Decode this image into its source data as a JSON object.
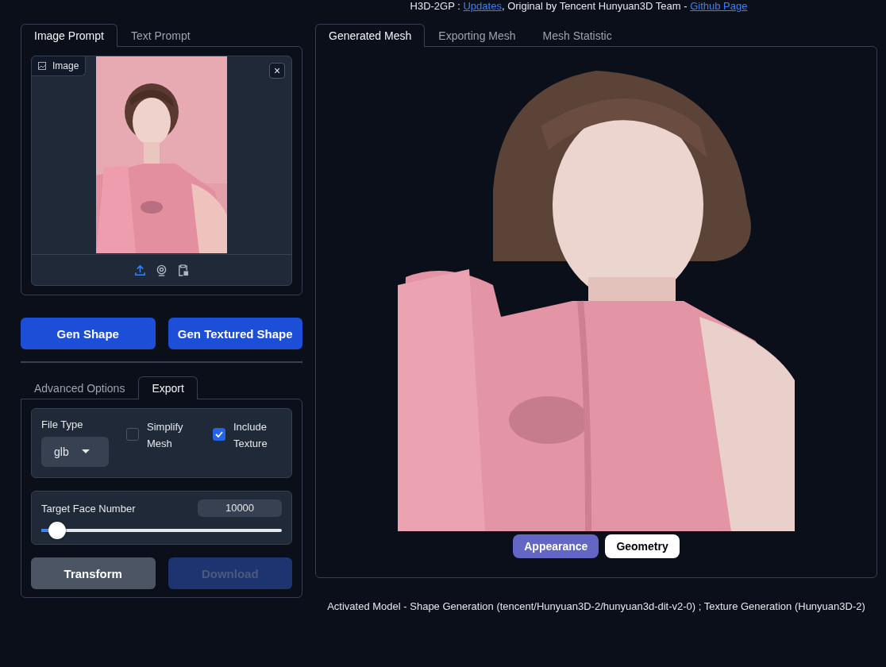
{
  "header": [
    {
      "kind": "text",
      "text": "H3D-2GP : "
    },
    {
      "kind": "link",
      "text": "Updates"
    },
    {
      "kind": "text",
      "text": ", Original by Tencent Hunyuan3D Team - "
    },
    {
      "kind": "link",
      "text": "Github Page"
    }
  ],
  "prompt_tabs": [
    {
      "label": "Image Prompt",
      "selected": true
    },
    {
      "label": "Text Prompt",
      "selected": false
    }
  ],
  "image_input": {
    "label": "Image",
    "close": "×"
  },
  "generate_buttons": [
    "Gen Shape",
    "Gen Textured Shape"
  ],
  "option_tabs": [
    {
      "label": "Advanced Options",
      "selected": false
    },
    {
      "label": "Export",
      "selected": true
    }
  ],
  "export": {
    "file_type": {
      "label": "File Type",
      "value": "glb"
    },
    "checkboxes": [
      {
        "label": "Simplify Mesh",
        "checked": false
      },
      {
        "label": "Include Texture",
        "checked": true
      }
    ],
    "target_face": {
      "label": "Target Face Number",
      "value": "10000",
      "level": 0.03
    },
    "buttons": [
      {
        "label": "Transform",
        "disabled": false
      },
      {
        "label": "Download",
        "disabled": true
      }
    ]
  },
  "view_tabs": [
    {
      "label": "Generated Mesh",
      "selected": true
    },
    {
      "label": "Exporting Mesh",
      "selected": false
    },
    {
      "label": "Mesh Statistic",
      "selected": false
    }
  ],
  "view_modes": [
    {
      "label": "Appearance",
      "selected": true
    },
    {
      "label": "Geometry",
      "selected": false
    }
  ],
  "footer": "Activated Model - Shape Generation (tencent/Hunyuan3D-2/hunyuan3d-dit-v2-0) ; Texture Generation (Hunyuan3D-2)"
}
